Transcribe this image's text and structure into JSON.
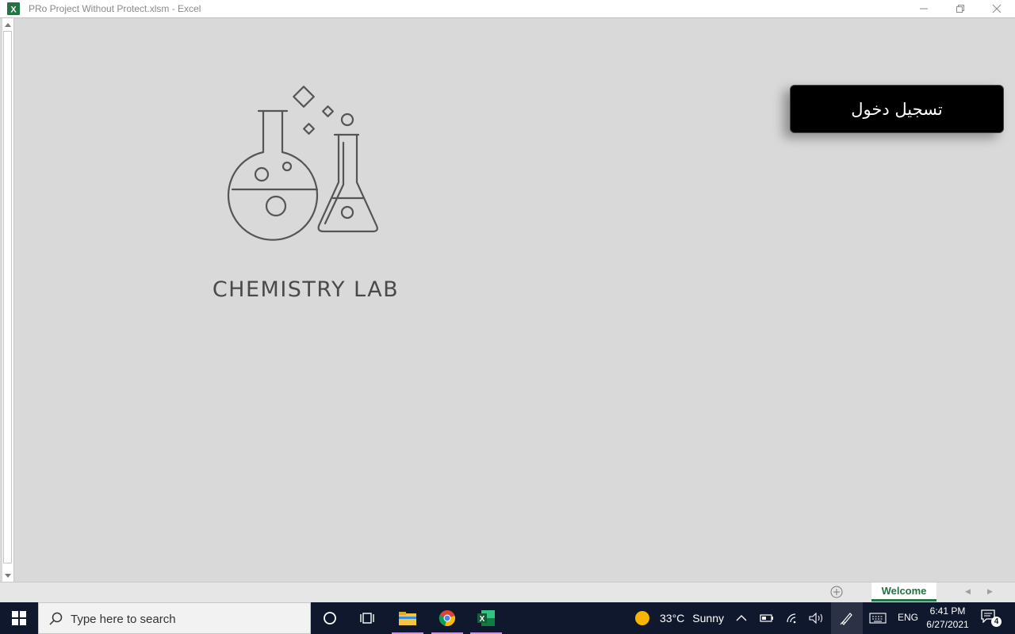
{
  "window": {
    "title": "PRo Project Without Protect.xlsm - Excel",
    "app_icon_letter": "X"
  },
  "sheet": {
    "logo_icon": "chemistry-flask-icon",
    "lab_title": "CHEMISTRY LAB",
    "login_button_label": "تسجيل دخول"
  },
  "tabs": {
    "active_tab": "Welcome"
  },
  "taskbar": {
    "search_placeholder": "Type here to search",
    "weather_temp": "33°C",
    "weather_desc": "Sunny",
    "language": "ENG",
    "time": "6:41 PM",
    "date": "6/27/2021",
    "notification_count": "4"
  },
  "colors": {
    "excel_green": "#217346",
    "taskbar_bg": "#10182e",
    "sheet_bg": "#d9d9d9",
    "login_button_bg": "#000000"
  }
}
